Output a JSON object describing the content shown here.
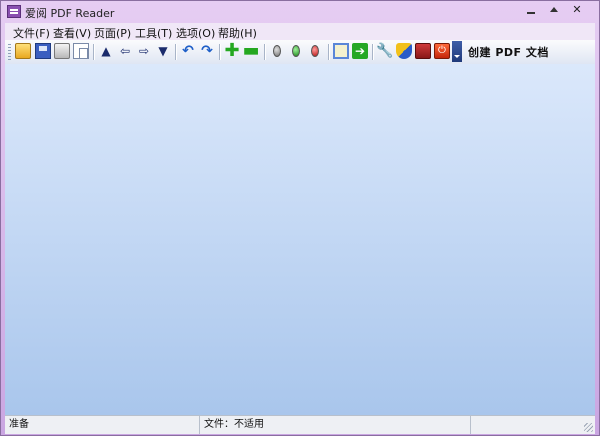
{
  "window": {
    "title": "爱阅 PDF Reader",
    "controls": {
      "minimize": "",
      "maximize": "",
      "close": "✕"
    }
  },
  "menu": [
    {
      "id": "file",
      "label": "文件(F)"
    },
    {
      "id": "view",
      "label": "查看(V)"
    },
    {
      "id": "page",
      "label": "页面(P)"
    },
    {
      "id": "tools",
      "label": "工具(T)"
    },
    {
      "id": "options",
      "label": "选项(O)"
    },
    {
      "id": "help",
      "label": "帮助(H)"
    }
  ],
  "toolbar": {
    "create_label": "创建 PDF 文档",
    "icons": {
      "up": "▲",
      "back": "⇦",
      "forward": "⇨",
      "down": "▼",
      "undo": "↶",
      "redo": "↷",
      "plus": "✚",
      "minus": "▬",
      "goto": "➔",
      "tools": "🔧",
      "power": "⏻"
    }
  },
  "statusbar": {
    "status": "准备",
    "file": "文件：不适用",
    "extra": ""
  },
  "colors": {
    "frame": "#caa6e2",
    "menubar": "#f0e7f7",
    "doc_top": "#dbe8fb",
    "doc_bottom": "#a9c6ec",
    "statusbar": "#eef0f4"
  }
}
